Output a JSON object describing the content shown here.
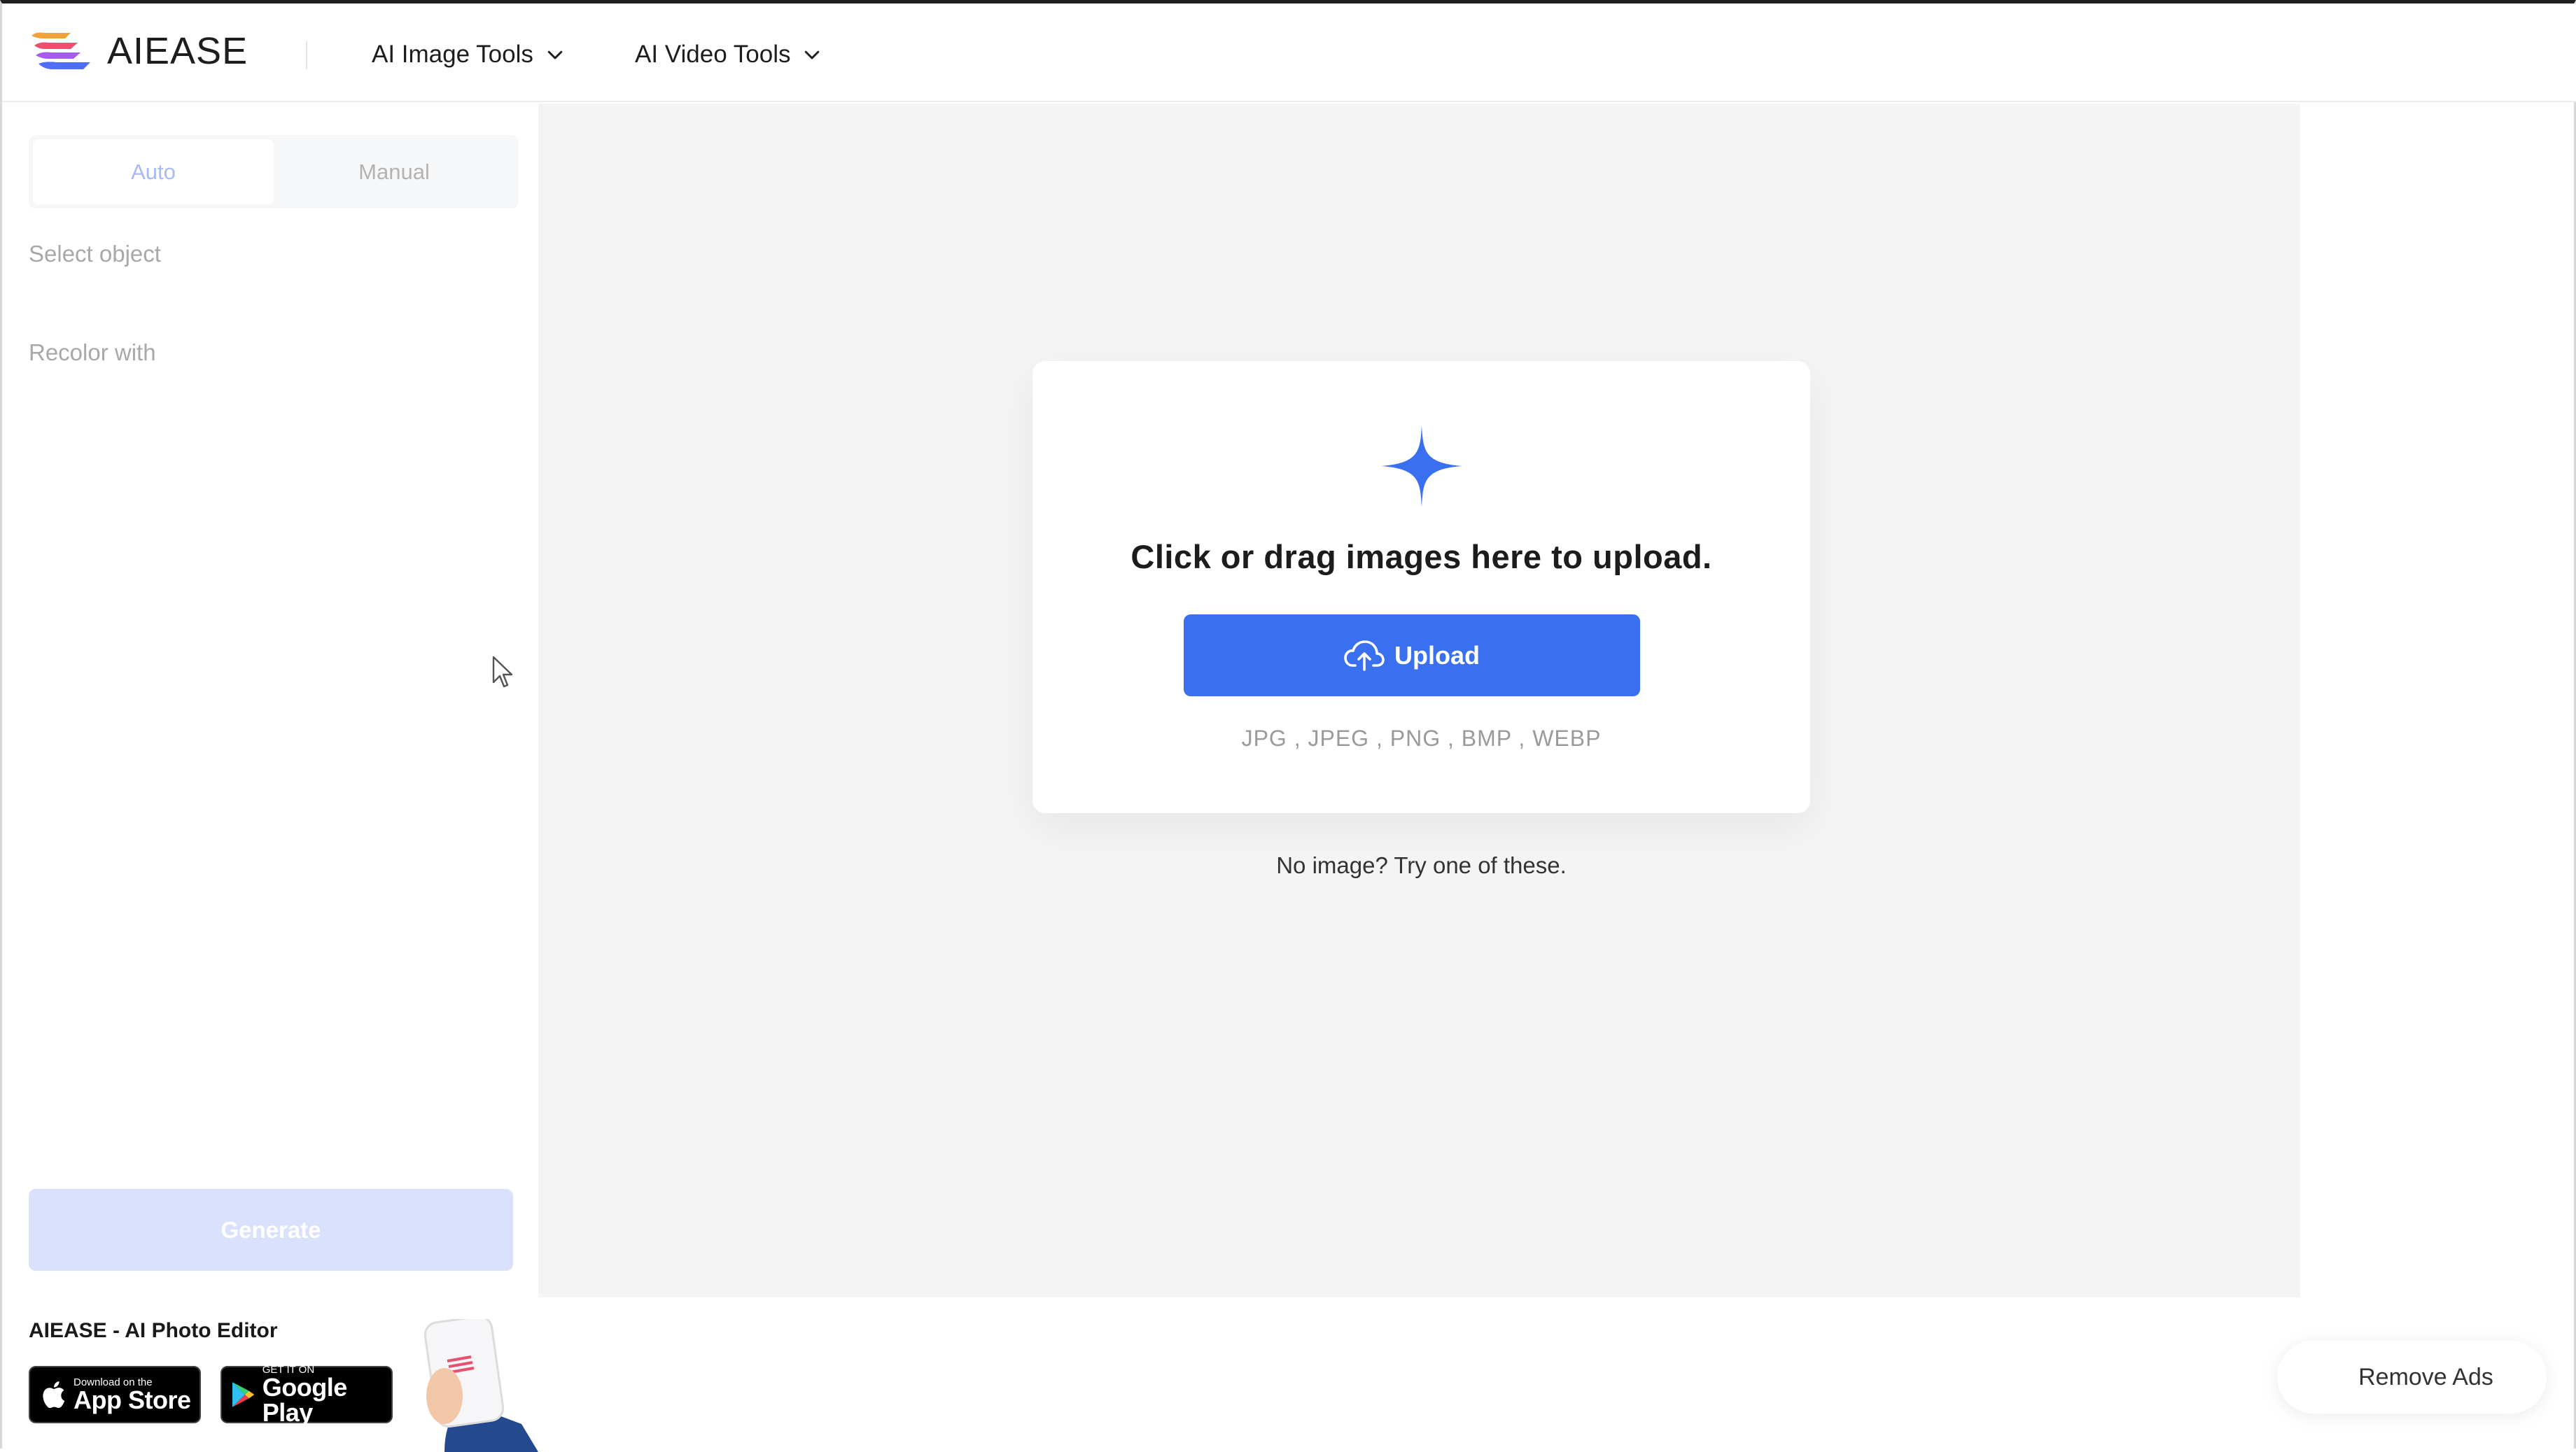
{
  "header": {
    "logo_text": "AIEASE",
    "nav": [
      {
        "label": "AI Image Tools"
      },
      {
        "label": "AI Video Tools"
      }
    ]
  },
  "sidebar": {
    "tabs": [
      {
        "label": "Auto",
        "active": true
      },
      {
        "label": "Manual",
        "active": false
      }
    ],
    "select_object_label": "Select object",
    "recolor_with_label": "Recolor with",
    "generate_label": "Generate",
    "app_promo": {
      "title": "AIEASE - AI Photo Editor",
      "app_store": {
        "small": "Download on the",
        "big": "App Store"
      },
      "google_play": {
        "small": "GET IT ON",
        "big": "Google Play"
      }
    }
  },
  "upload": {
    "title": "Click or drag images here to upload.",
    "button_label": "Upload",
    "formats": "JPG , JPEG , PNG , BMP , WEBP",
    "try_text": "No image? Try one of these."
  },
  "remove_ads_label": "Remove Ads",
  "colors": {
    "accent": "#3a6ff0",
    "generate_disabled": "#d9e1fd",
    "canvas_bg": "#f4f4f5"
  },
  "icons": {
    "logo": "aiease-logo-icon",
    "nav_chevron": "chevron-down-icon",
    "sparkle": "sparkle-icon",
    "upload": "cloud-upload-icon",
    "apple": "apple-icon",
    "google_play": "google-play-icon"
  }
}
